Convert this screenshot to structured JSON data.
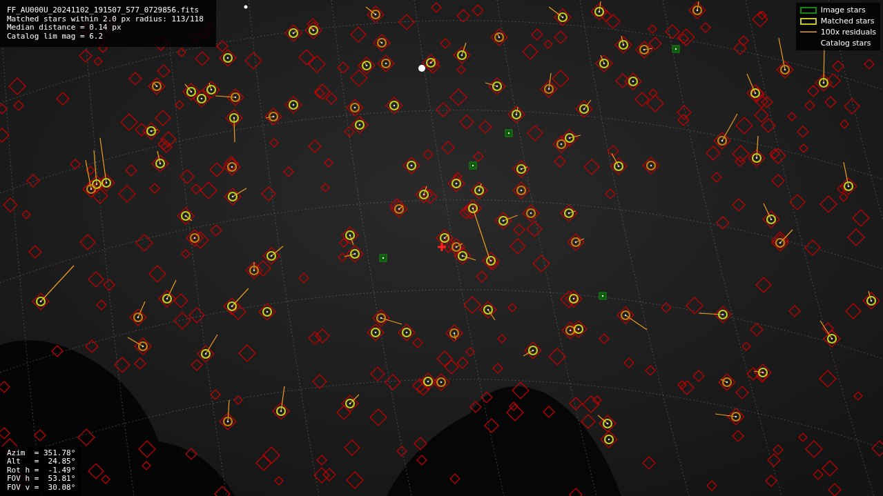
{
  "header": {
    "lines": [
      "FF_AU000U_20241102_191507_577_0729856.fits",
      "Matched stars within 2.0 px radius: 113/118",
      "Median distance = 0.14 px",
      "Catalog lim mag = 6.2"
    ]
  },
  "legend": [
    {
      "kind": "image",
      "label": "Image stars"
    },
    {
      "kind": "matched",
      "label": "Matched stars"
    },
    {
      "kind": "residual",
      "label": "100x residuals"
    },
    {
      "kind": "catalog",
      "label": "Catalog stars"
    }
  ],
  "pointing": {
    "lines": [
      "Azim  = 351.78°",
      "Alt   =  24.85°",
      "Rot h =  -1.49°",
      "FOV h =  53.81°",
      "FOV v =  30.08°"
    ]
  }
}
